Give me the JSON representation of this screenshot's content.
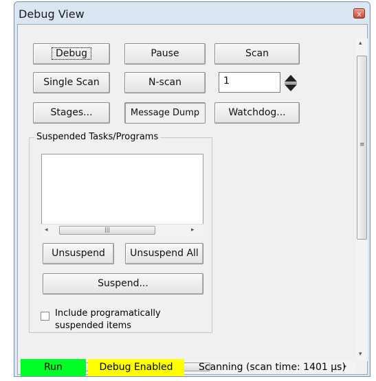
{
  "window": {
    "title": "Debug View",
    "close_glyph": "x"
  },
  "buttons": {
    "debug": "Debug",
    "pause": "Pause",
    "scan": "Scan",
    "single_scan": "Single Scan",
    "n_scan": "N-scan",
    "stages": "Stages...",
    "message_dump": "Message Dump",
    "watchdog": "Watchdog..."
  },
  "nscan_count": "1",
  "suspended_group": {
    "label": "Suspended Tasks/Programs",
    "items": [],
    "unsuspend": "Unsuspend",
    "unsuspend_all": "Unsuspend All",
    "suspend": "Suspend...",
    "include_checkbox_line1": "Include programatically",
    "include_checkbox_line2": "suspended items",
    "include_checked": false
  },
  "status": {
    "run": "Run",
    "debug": "Debug Enabled",
    "scan": "Scanning (scan time: 1401 µs)",
    "run_color": "#00ff26",
    "debug_color": "#ffff00"
  }
}
